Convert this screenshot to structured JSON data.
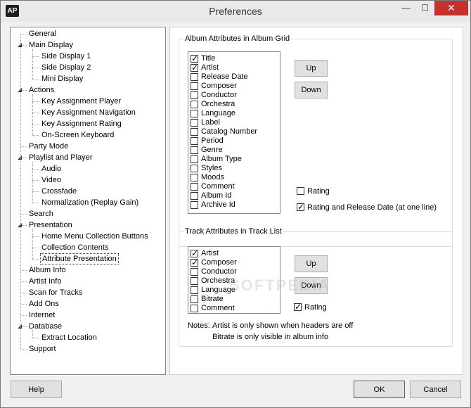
{
  "window": {
    "title": "Preferences",
    "app_icon_text": "AP",
    "minimize_glyph": "—",
    "maximize_glyph": "☐",
    "close_glyph": "✕"
  },
  "tree": {
    "items": [
      {
        "label": "General",
        "level": 0,
        "expandable": false
      },
      {
        "label": "Main Display",
        "level": 0,
        "expandable": true
      },
      {
        "label": "Side Display 1",
        "level": 1,
        "expandable": false
      },
      {
        "label": "Side Display 2",
        "level": 1,
        "expandable": false
      },
      {
        "label": "Mini Display",
        "level": 1,
        "expandable": false
      },
      {
        "label": "Actions",
        "level": 0,
        "expandable": true
      },
      {
        "label": "Key Assignment Player",
        "level": 1,
        "expandable": false
      },
      {
        "label": "Key Assignment Navigation",
        "level": 1,
        "expandable": false
      },
      {
        "label": "Key Assignment Rating",
        "level": 1,
        "expandable": false
      },
      {
        "label": "On-Screen Keyboard",
        "level": 1,
        "expandable": false
      },
      {
        "label": "Party Mode",
        "level": 0,
        "expandable": false
      },
      {
        "label": "Playlist and Player",
        "level": 0,
        "expandable": true
      },
      {
        "label": "Audio",
        "level": 1,
        "expandable": false
      },
      {
        "label": "Video",
        "level": 1,
        "expandable": false
      },
      {
        "label": "Crossfade",
        "level": 1,
        "expandable": false
      },
      {
        "label": "Normalization (Replay Gain)",
        "level": 1,
        "expandable": false
      },
      {
        "label": "Search",
        "level": 0,
        "expandable": false
      },
      {
        "label": "Presentation",
        "level": 0,
        "expandable": true
      },
      {
        "label": "Home Menu Collection Buttons",
        "level": 1,
        "expandable": false
      },
      {
        "label": "Collection Contents",
        "level": 1,
        "expandable": false
      },
      {
        "label": "Attribute Presentation",
        "level": 1,
        "expandable": false,
        "selected": true
      },
      {
        "label": "Album Info",
        "level": 0,
        "expandable": false
      },
      {
        "label": "Artist Info",
        "level": 0,
        "expandable": false
      },
      {
        "label": "Scan for Tracks",
        "level": 0,
        "expandable": false
      },
      {
        "label": "Add Ons",
        "level": 0,
        "expandable": false
      },
      {
        "label": "Internet",
        "level": 0,
        "expandable": false
      },
      {
        "label": "Database",
        "level": 0,
        "expandable": true
      },
      {
        "label": "Extract Location",
        "level": 1,
        "expandable": false
      },
      {
        "label": "Support",
        "level": 0,
        "expandable": false
      }
    ]
  },
  "album_group": {
    "label": "Album Attributes in Album Grid",
    "attributes": [
      {
        "label": "Title",
        "checked": true
      },
      {
        "label": "Artist",
        "checked": true
      },
      {
        "label": "Release Date",
        "checked": false
      },
      {
        "label": "Composer",
        "checked": false
      },
      {
        "label": "Conductor",
        "checked": false
      },
      {
        "label": "Orchestra",
        "checked": false
      },
      {
        "label": "Language",
        "checked": false
      },
      {
        "label": "Label",
        "checked": false
      },
      {
        "label": "Catalog Number",
        "checked": false
      },
      {
        "label": "Period",
        "checked": false
      },
      {
        "label": "Genre",
        "checked": false
      },
      {
        "label": "Album Type",
        "checked": false
      },
      {
        "label": "Styles",
        "checked": false
      },
      {
        "label": "Moods",
        "checked": false
      },
      {
        "label": "Comment",
        "checked": false
      },
      {
        "label": "Album Id",
        "checked": false
      },
      {
        "label": "Archive Id",
        "checked": false
      }
    ],
    "up_label": "Up",
    "down_label": "Down",
    "rating_label": "Rating",
    "rating_checked": false,
    "rating_release_label": "Rating and Release Date (at one line)",
    "rating_release_checked": true
  },
  "track_group": {
    "label": "Track Attributes in Track List",
    "attributes": [
      {
        "label": "Artist",
        "checked": true
      },
      {
        "label": "Composer",
        "checked": true
      },
      {
        "label": "Conductor",
        "checked": false
      },
      {
        "label": "Orchestra",
        "checked": false
      },
      {
        "label": "Language",
        "checked": false
      },
      {
        "label": "Bitrate",
        "checked": false
      },
      {
        "label": "Comment",
        "checked": false
      }
    ],
    "up_label": "Up",
    "down_label": "Down",
    "rating_label": "Rating",
    "rating_checked": true,
    "notes_prefix": "Notes:",
    "note_1": "Artist is only shown when headers are off",
    "note_2": "Bitrate is only visible in album info"
  },
  "footer": {
    "help_label": "Help",
    "ok_label": "OK",
    "cancel_label": "Cancel"
  },
  "watermark": "SOFTPEDIA"
}
